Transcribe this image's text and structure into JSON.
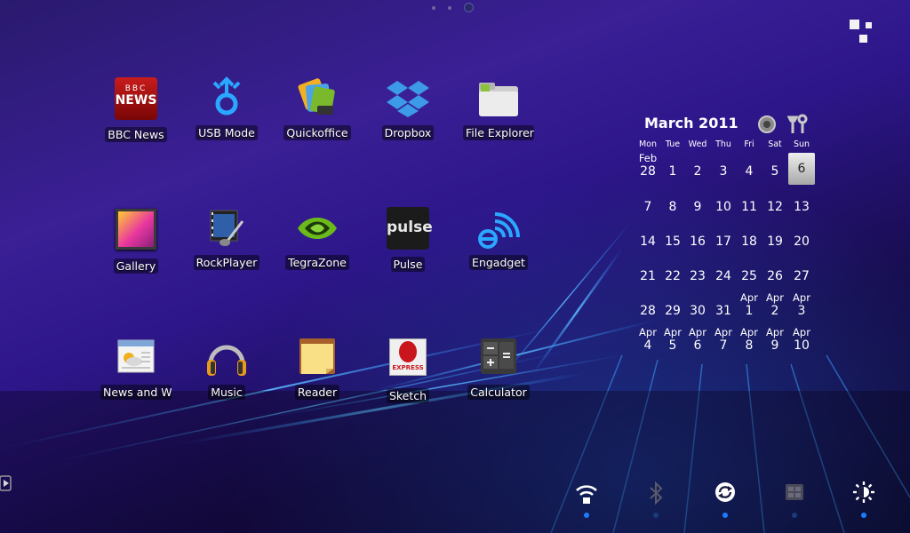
{
  "home_pages": {
    "count": 3,
    "current": 3
  },
  "apps": [
    {
      "label": "BBC News",
      "icon": "bbc-news-icon"
    },
    {
      "label": "USB Mode",
      "icon": "usb-mode-icon"
    },
    {
      "label": "Quickoffice",
      "icon": "quickoffice-icon"
    },
    {
      "label": "Dropbox",
      "icon": "dropbox-icon"
    },
    {
      "label": "File Explorer",
      "icon": "file-explorer-icon"
    },
    {
      "label": "Gallery",
      "icon": "gallery-icon"
    },
    {
      "label": "RockPlayer",
      "icon": "rockplayer-icon"
    },
    {
      "label": "TegraZone",
      "icon": "tegrazone-icon"
    },
    {
      "label": "Pulse",
      "icon": "pulse-icon"
    },
    {
      "label": "Engadget",
      "icon": "engadget-icon"
    },
    {
      "label": "News and Weather",
      "icon": "news-and-weather-icon"
    },
    {
      "label": "Music",
      "icon": "music-headphones-icon"
    },
    {
      "label": "Reader",
      "icon": "reader-notepad-icon"
    },
    {
      "label": "Sketch",
      "icon": "sketch-express-icon"
    },
    {
      "label": "Calculator",
      "icon": "calculator-icon"
    }
  ],
  "bbc_logo": {
    "line1": "BBC",
    "line2": "NEWS"
  },
  "pulse_logo": "pulse",
  "sketch_logo": "EXPRESS",
  "calendar": {
    "title": "March 2011",
    "weekdays": [
      "Mon",
      "Tue",
      "Wed",
      "Thu",
      "Fri",
      "Sat",
      "Sun"
    ],
    "today": 6,
    "weeks": [
      [
        {
          "m": "Feb",
          "d": "28"
        },
        {
          "d": "1"
        },
        {
          "d": "2"
        },
        {
          "d": "3"
        },
        {
          "d": "4"
        },
        {
          "d": "5"
        },
        {
          "d": "6"
        }
      ],
      [
        {
          "d": "7"
        },
        {
          "d": "8"
        },
        {
          "d": "9"
        },
        {
          "d": "10"
        },
        {
          "d": "11"
        },
        {
          "d": "12"
        },
        {
          "d": "13"
        }
      ],
      [
        {
          "d": "14"
        },
        {
          "d": "15"
        },
        {
          "d": "16"
        },
        {
          "d": "17"
        },
        {
          "d": "18"
        },
        {
          "d": "19"
        },
        {
          "d": "20"
        }
      ],
      [
        {
          "d": "21"
        },
        {
          "d": "22"
        },
        {
          "d": "23"
        },
        {
          "d": "24"
        },
        {
          "d": "25"
        },
        {
          "d": "26"
        },
        {
          "d": "27"
        }
      ],
      [
        {
          "d": "28"
        },
        {
          "d": "29"
        },
        {
          "d": "30"
        },
        {
          "d": "31"
        },
        {
          "m": "Apr",
          "d": "1"
        },
        {
          "m": "Apr",
          "d": "2"
        },
        {
          "m": "Apr",
          "d": "3"
        }
      ],
      [
        {
          "m": "Apr",
          "d": "4"
        },
        {
          "m": "Apr",
          "d": "5"
        },
        {
          "m": "Apr",
          "d": "6"
        },
        {
          "m": "Apr",
          "d": "7"
        },
        {
          "m": "Apr",
          "d": "8"
        },
        {
          "m": "Apr",
          "d": "9"
        },
        {
          "m": "Apr",
          "d": "10"
        }
      ]
    ],
    "icons": [
      "timer-dial-icon",
      "settings-tools-icon"
    ]
  },
  "quick_settings": [
    {
      "icon": "wifi-icon",
      "on": true
    },
    {
      "icon": "bluetooth-icon",
      "on": false
    },
    {
      "icon": "auto-sync-icon",
      "on": true
    },
    {
      "icon": "mobile-data-3g-icon",
      "on": false
    },
    {
      "icon": "brightness-icon",
      "on": true
    }
  ],
  "colors": {
    "accent": "#1c7cff",
    "accent_off": "#1a3b7a"
  }
}
